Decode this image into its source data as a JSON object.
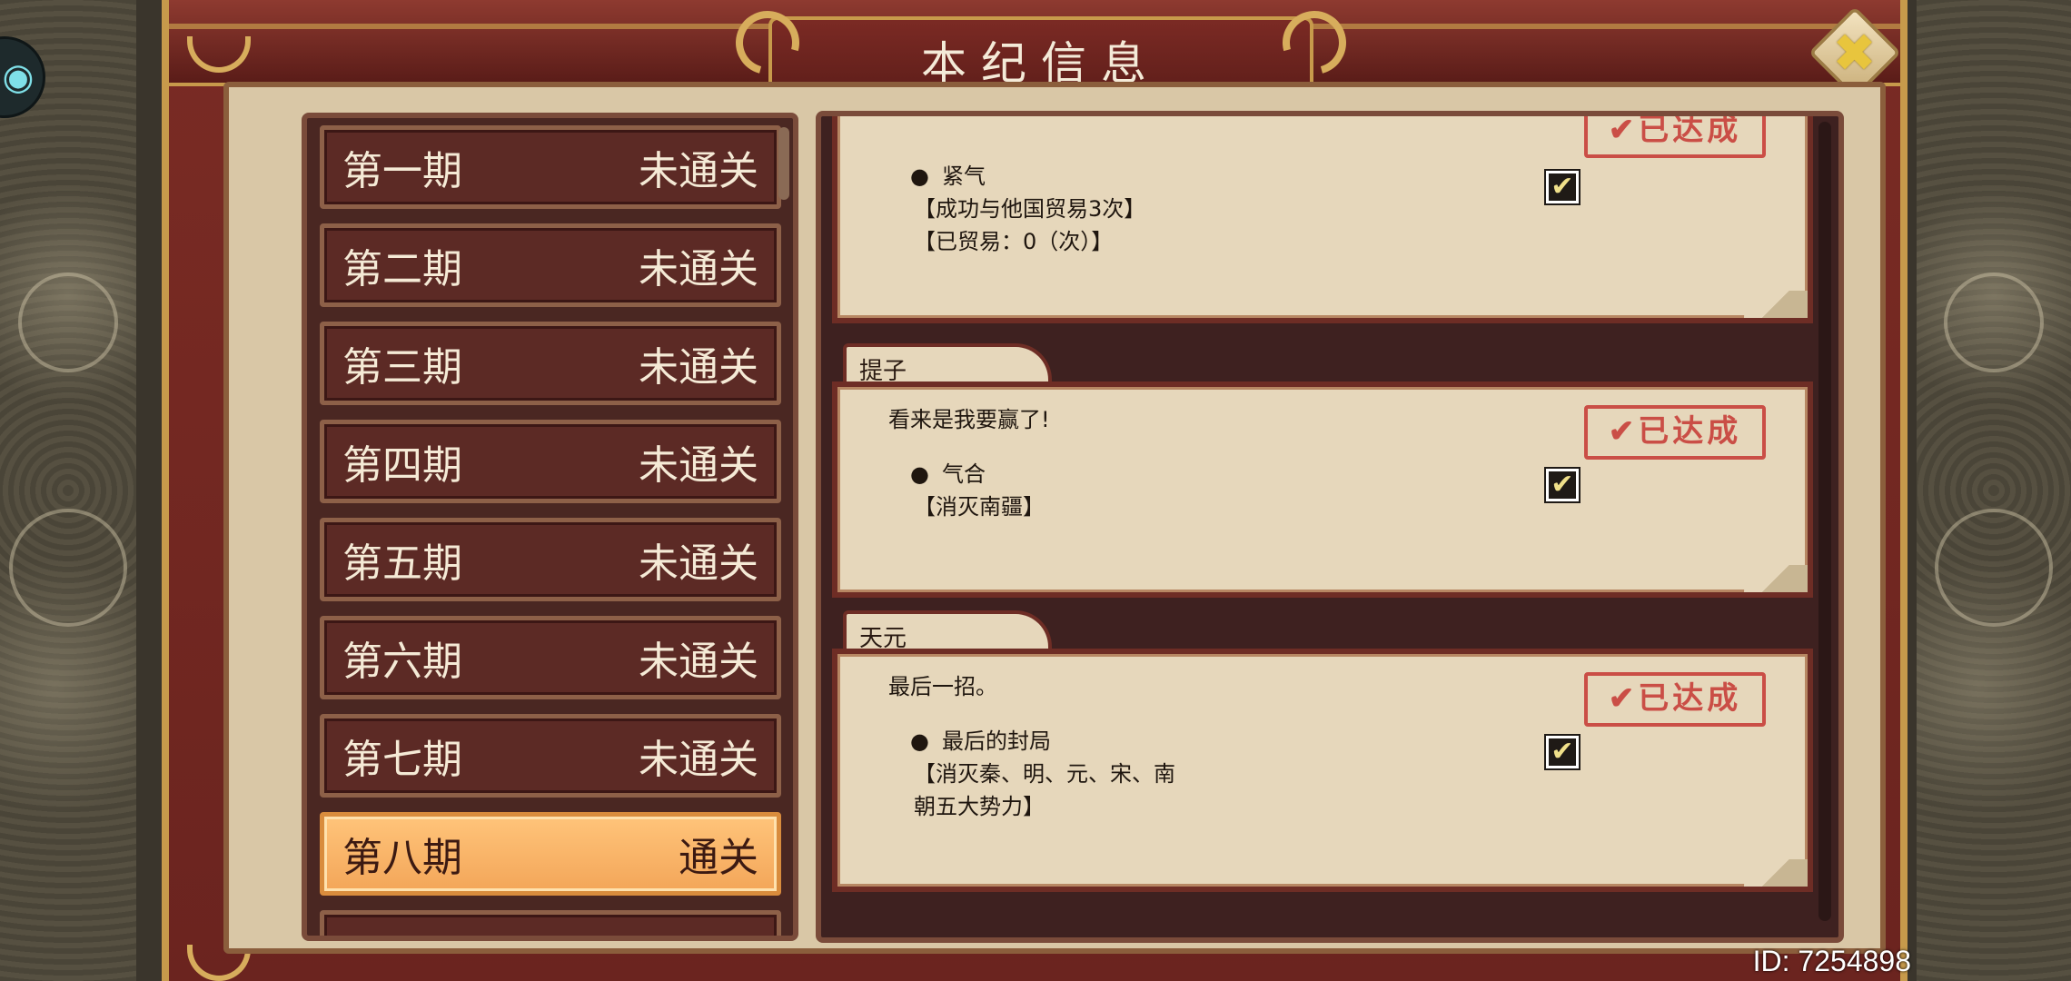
{
  "window": {
    "title": "本纪信息"
  },
  "controls": {
    "close_icon": "✖",
    "avatar_icon": "dragon-face-icon"
  },
  "periods": [
    {
      "name": "第一期",
      "status": "未通关"
    },
    {
      "name": "第二期",
      "status": "未通关"
    },
    {
      "name": "第三期",
      "status": "未通关"
    },
    {
      "name": "第四期",
      "status": "未通关"
    },
    {
      "name": "第五期",
      "status": "未通关"
    },
    {
      "name": "第六期",
      "status": "未通关"
    },
    {
      "name": "第七期",
      "status": "未通关"
    },
    {
      "name": "第八期",
      "status": "通关",
      "selected": true
    }
  ],
  "achievements": [
    {
      "character": "",
      "quote": "",
      "goal_name": "紧气",
      "goal_desc": "【成功与他国贸易3次】",
      "goal_progress": "【已贸易：0（次）】",
      "completed": true,
      "stamp": "✔已达成"
    },
    {
      "character": "提子",
      "quote": "看来是我要赢了!",
      "goal_name": "气合",
      "goal_desc": "【消灭南疆】",
      "goal_progress": "",
      "completed": true,
      "stamp": "✔已达成"
    },
    {
      "character": "天元",
      "quote": "最后一招。",
      "goal_name": "最后的封局",
      "goal_desc": "【消灭秦、明、元、宋、南",
      "goal_progress": "朝五大势力】",
      "completed": true,
      "stamp": "✔已达成"
    }
  ],
  "footer": {
    "player_id": "ID: 7254898"
  },
  "colors": {
    "frame": "#6b241f",
    "gold": "#c79a4b",
    "selected": "#ffc47a",
    "stamp": "#c8403a"
  }
}
